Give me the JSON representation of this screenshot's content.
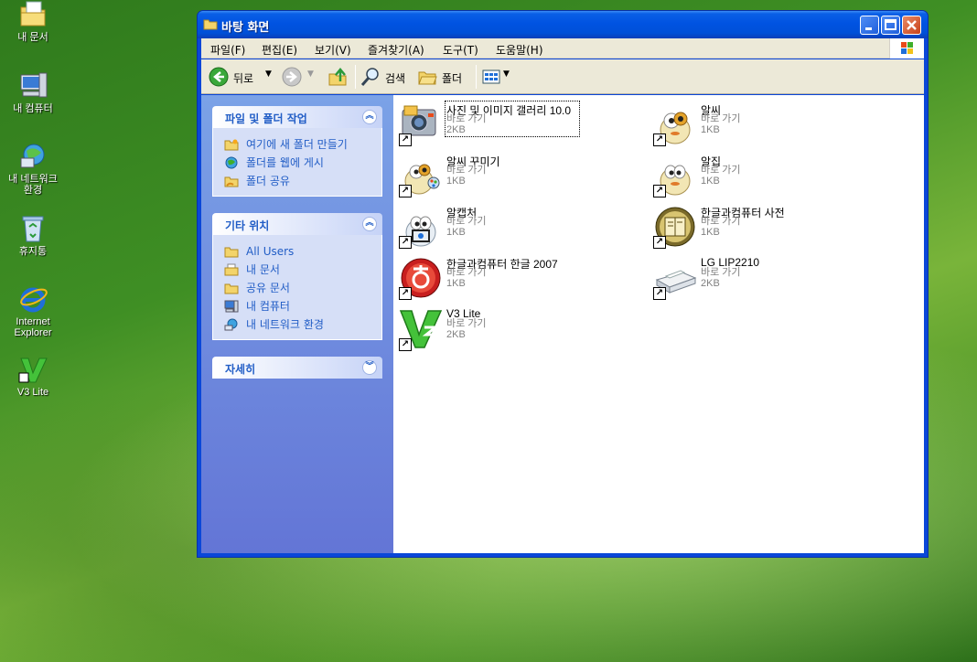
{
  "desktop": {
    "icons": [
      {
        "label": "내 문서",
        "icon": "my-documents-icon"
      },
      {
        "label": "내 컴퓨터",
        "icon": "my-computer-icon"
      },
      {
        "label_line1": "내 네트워크",
        "label_line2": "환경",
        "icon": "network-icon"
      },
      {
        "label": "휴지통",
        "icon": "recycle-bin-icon"
      },
      {
        "label_line1": "Internet",
        "label_line2": "Explorer",
        "icon": "internet-explorer-icon"
      },
      {
        "label": "V3 Lite",
        "icon": "v3-lite-icon"
      }
    ]
  },
  "window": {
    "title": "바탕 화면",
    "menu": [
      "파일(F)",
      "편집(E)",
      "보기(V)",
      "즐겨찾기(A)",
      "도구(T)",
      "도움말(H)"
    ],
    "toolbar": {
      "back": "뒤로",
      "search": "검색",
      "folders": "폴더"
    }
  },
  "taskpane": {
    "file_tasks": {
      "title": "파일 및 폴더 작업",
      "items": [
        "여기에 새 폴더 만들기",
        "폴더를 웹에 게시",
        "폴더 공유"
      ]
    },
    "other_places": {
      "title": "기타 위치",
      "items": [
        "All Users",
        "내 문서",
        "공유 문서",
        "내 컴퓨터",
        "내 네트워크 환경"
      ]
    },
    "details": {
      "title": "자세히"
    }
  },
  "files": [
    {
      "name": "사진 및 이미지 갤러리 10.0",
      "type": "바로 가기",
      "size": "2KB"
    },
    {
      "name": "알씨",
      "type": "바로 가기",
      "size": "1KB"
    },
    {
      "name": "알씨 꾸미기",
      "type": "바로 가기",
      "size": "1KB"
    },
    {
      "name": "알집",
      "type": "바로 가기",
      "size": "1KB"
    },
    {
      "name": "알캡처",
      "type": "바로 가기",
      "size": "1KB"
    },
    {
      "name": "한글과컴퓨터 사전",
      "type": "바로 가기",
      "size": "1KB"
    },
    {
      "name": "한글과컴퓨터 한글 2007",
      "type": "바로 가기",
      "size": "1KB"
    },
    {
      "name": "LG LIP2210",
      "type": "바로 가기",
      "size": "2KB"
    },
    {
      "name": "V3 Lite",
      "type": "바로 가기",
      "size": "2KB"
    }
  ],
  "colors": {
    "accent": "#0a47d8",
    "link": "#215dc6",
    "pane": "#7ba2e7"
  }
}
